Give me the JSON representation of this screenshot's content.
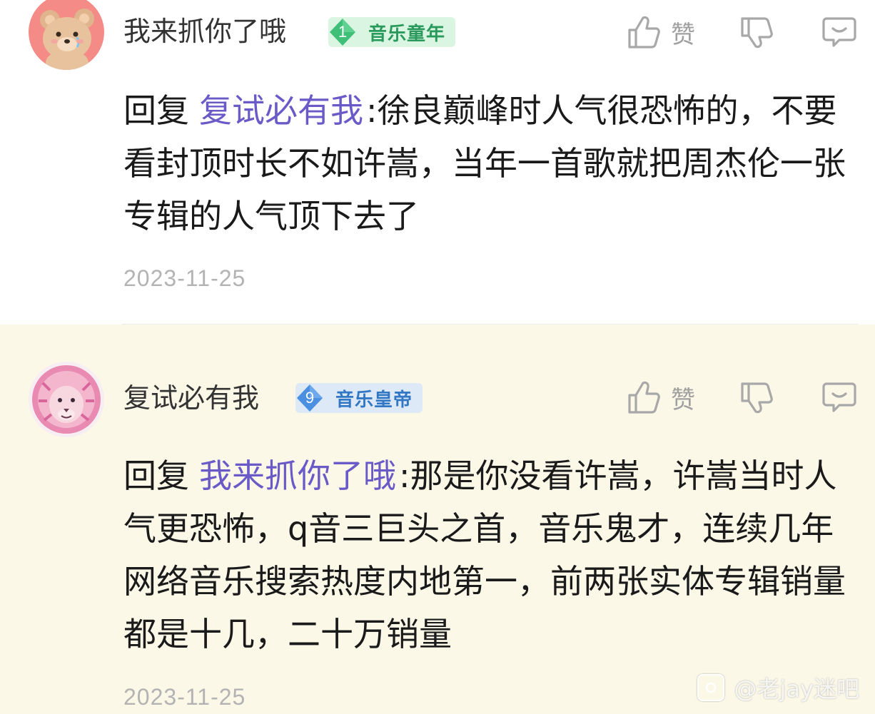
{
  "comments": [
    {
      "username": "我来抓你了哦",
      "badge_level": "1",
      "badge_title": "音乐童年",
      "like_label": "赞",
      "reply_prefix": "回复",
      "reply_target": "复试必有我",
      "content": ":徐良巅峰时人气很恐怖的，不要看封顶时长不如许嵩，当年一首歌就把周杰伦一张专辑的人气顶下去了",
      "date": "2023-11-25",
      "avatar_icon": "bear-avatar-icon",
      "badge_color": "#2a9a5c"
    },
    {
      "username": "复试必有我",
      "badge_level": "9",
      "badge_title": "音乐皇帝",
      "like_label": "赞",
      "reply_prefix": "回复",
      "reply_target": "我来抓你了哦",
      "content": ":那是你没看许嵩，许嵩当时人气更恐怖，q音三巨头之首，音乐鬼才，连续几年网络音乐搜索热度内地第一，前两张实体专辑销量都是十几，二十万销量",
      "date": "2023-11-25",
      "avatar_icon": "pink-lion-avatar-icon",
      "badge_color": "#3277c4"
    }
  ],
  "watermark": {
    "text": "@老jay迷吧",
    "icon": "tieba-logo-icon"
  },
  "colors": {
    "reply_target": "#6a5ac8",
    "highlight_background": "#fbf8e8"
  }
}
